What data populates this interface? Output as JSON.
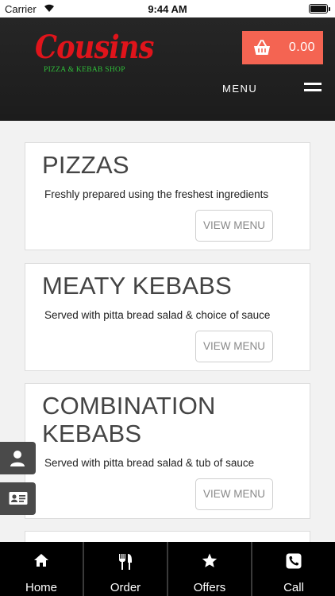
{
  "status_bar": {
    "carrier": "Carrier",
    "time": "9:44 AM"
  },
  "header": {
    "logo_title": "Cousins",
    "logo_subtitle": "PIZZA & KEBAB SHOP",
    "cart_total": "0.00",
    "cart_icon": "basket-icon",
    "menu_label": "MENU",
    "menu_icon": "hamburger-icon"
  },
  "categories": [
    {
      "title": "PIZZAS",
      "description": "Freshly prepared using the freshest ingredients",
      "button": "VIEW MENU"
    },
    {
      "title": "MEATY KEBABS",
      "description": "Served with pitta bread salad & choice of sauce",
      "button": "VIEW MENU"
    },
    {
      "title": "COMBINATION KEBABS",
      "description": "Served with pitta bread salad & tub of sauce",
      "button": "VIEW MENU"
    }
  ],
  "side_tabs": [
    {
      "icon": "user-icon"
    },
    {
      "icon": "contact-card-icon"
    }
  ],
  "bottom_nav": [
    {
      "label": "Home",
      "icon": "home-icon"
    },
    {
      "label": "Order",
      "icon": "cutlery-icon"
    },
    {
      "label": "Offers",
      "icon": "star-icon"
    },
    {
      "label": "Call",
      "icon": "phone-icon"
    }
  ],
  "colors": {
    "header_bg": "#222222",
    "brand_red": "#e0141b",
    "brand_green": "#2fbf3a",
    "cart_accent": "#f46452",
    "nav_bg": "#000000"
  }
}
